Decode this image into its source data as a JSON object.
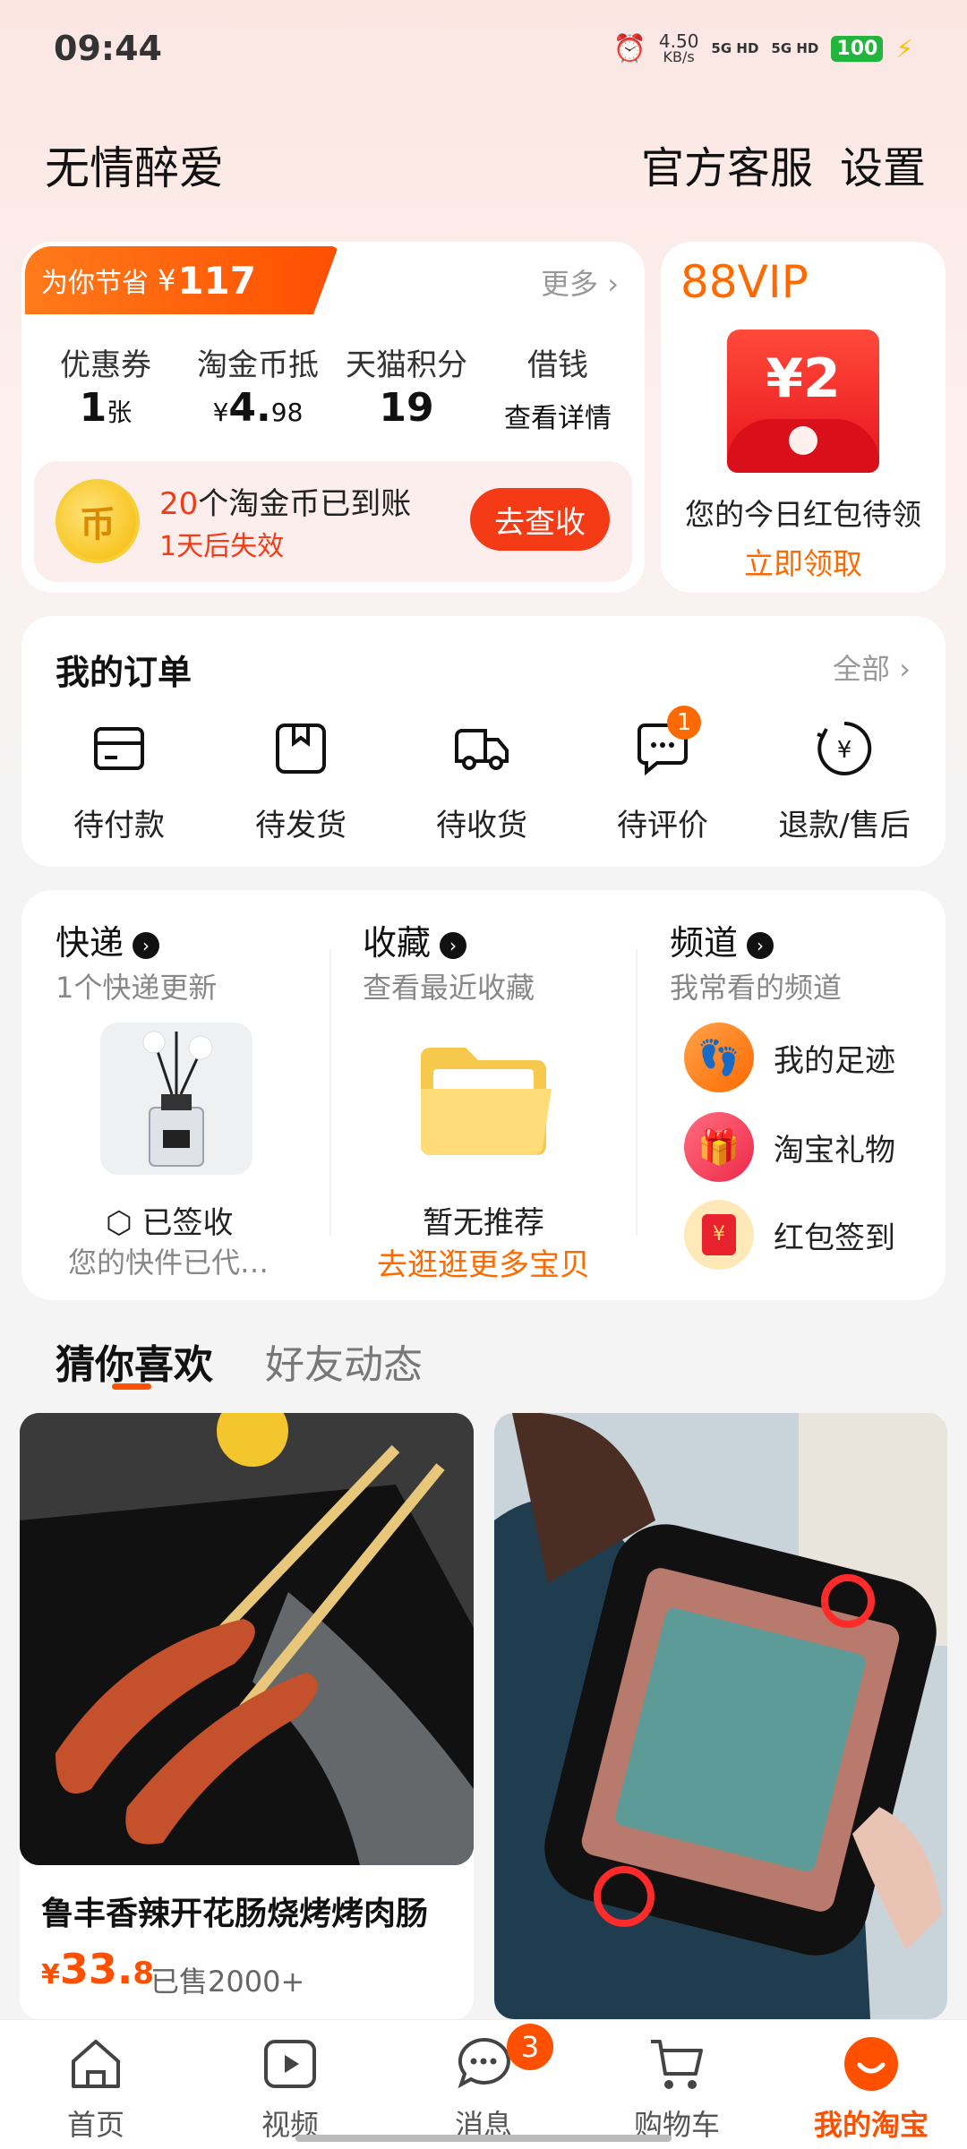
{
  "status_bar": {
    "time": "09:44",
    "speed": "4.50",
    "speed_unit": "KB/s",
    "net1": "5G HD",
    "net2": "5G HD",
    "battery": "100"
  },
  "header": {
    "username": "无情醉爱",
    "service": "官方客服",
    "settings": "设置"
  },
  "savings": {
    "tag_label": "为你节省",
    "currency": "¥",
    "amount": "117",
    "more": "更多",
    "stats": [
      {
        "label": "优惠券",
        "value": "1",
        "unit": "张"
      },
      {
        "label": "淘金币抵",
        "prefix": "¥",
        "value": "4.",
        "decimal": "98"
      },
      {
        "label": "天猫积分",
        "value": "19"
      },
      {
        "label": "借钱",
        "value": "查看详情"
      }
    ],
    "coin_count": "20",
    "coin_text": "个淘金币已到账",
    "coin_expire": "1天后失效",
    "coin_button": "去查收"
  },
  "vip": {
    "title": "88VIP",
    "amount": "¥2",
    "text": "您的今日红包待领",
    "link": "立即领取"
  },
  "orders": {
    "title": "我的订单",
    "all": "全部",
    "items": [
      {
        "label": "待付款",
        "icon": "wallet-icon"
      },
      {
        "label": "待发货",
        "icon": "package-icon"
      },
      {
        "label": "待收货",
        "icon": "truck-icon"
      },
      {
        "label": "待评价",
        "icon": "comment-icon",
        "badge": "1"
      },
      {
        "label": "退款/售后",
        "icon": "refund-icon"
      }
    ]
  },
  "services": {
    "express": {
      "title": "快递",
      "subtitle": "1个快递更新",
      "status": "已签收",
      "desc": "您的快件已代…"
    },
    "favorites": {
      "title": "收藏",
      "subtitle": "查看最近收藏",
      "status": "暂无推荐",
      "link": "去逛逛更多宝贝"
    },
    "channels": {
      "title": "频道",
      "subtitle": "我常看的频道",
      "items": [
        "我的足迹",
        "淘宝礼物",
        "红包签到"
      ]
    }
  },
  "feed_tabs": {
    "active": "猜你喜欢",
    "other": "好友动态"
  },
  "products": [
    {
      "title": "鲁丰香辣开花肠烧烤烤肉肠",
      "currency": "¥",
      "price_int": "33.",
      "price_dec": "8",
      "sold": "已售2000+"
    }
  ],
  "bottom_nav": {
    "items": [
      {
        "label": "首页",
        "icon": "home-icon"
      },
      {
        "label": "视频",
        "icon": "video-icon"
      },
      {
        "label": "消息",
        "icon": "message-icon",
        "badge": "3"
      },
      {
        "label": "购物车",
        "icon": "cart-icon"
      },
      {
        "label": "我的淘宝",
        "icon": "profile-icon"
      }
    ]
  },
  "colors": {
    "accent": "#ff5000",
    "red": "#f53b16",
    "vip_orange": "#ff6a00"
  }
}
